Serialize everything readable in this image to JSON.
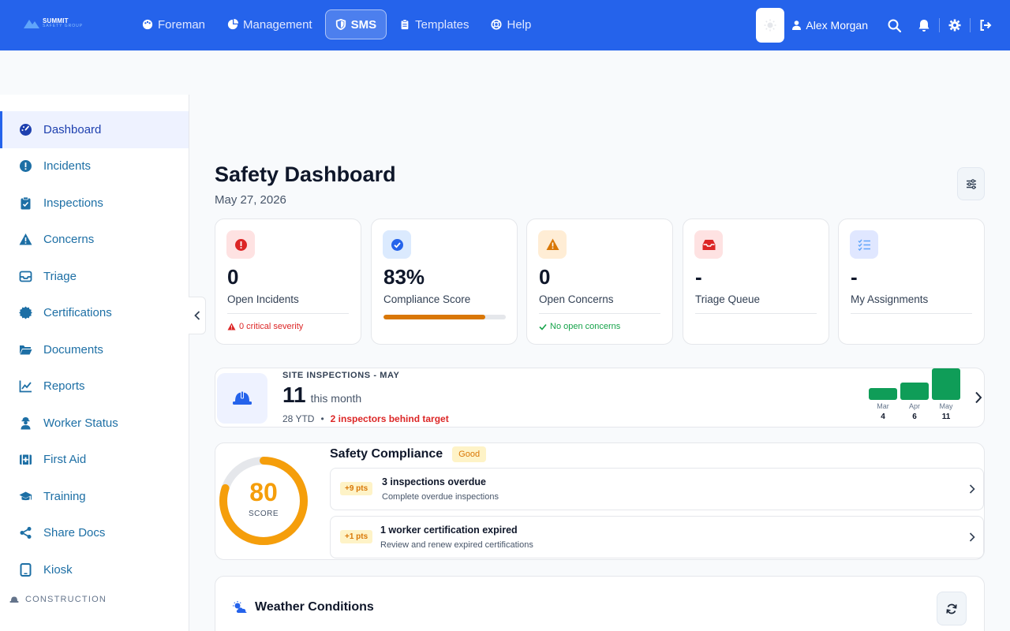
{
  "brand": {
    "name": "SUMMIT",
    "subtitle": "SAFETY GROUP"
  },
  "nav": [
    {
      "label": "Foreman",
      "icon": "palette-icon"
    },
    {
      "label": "Management",
      "icon": "pie-chart-icon"
    },
    {
      "label": "SMS",
      "icon": "shield-icon",
      "active": true
    },
    {
      "label": "Templates",
      "icon": "clipboard-icon"
    },
    {
      "label": "Help",
      "icon": "lifebuoy-icon"
    }
  ],
  "user": {
    "name": "Alex Morgan"
  },
  "sidebar": {
    "items": [
      {
        "label": "Dashboard",
        "icon": "gauge-icon",
        "active": true
      },
      {
        "label": "Incidents",
        "icon": "alert-circle-icon"
      },
      {
        "label": "Inspections",
        "icon": "clipboard-check-icon"
      },
      {
        "label": "Concerns",
        "icon": "warning-icon"
      },
      {
        "label": "Triage",
        "icon": "inbox-icon"
      },
      {
        "label": "Certifications",
        "icon": "certificate-icon"
      },
      {
        "label": "Documents",
        "icon": "folder-icon"
      },
      {
        "label": "Reports",
        "icon": "chart-line-icon"
      },
      {
        "label": "Worker Status",
        "icon": "worker-icon"
      },
      {
        "label": "First Aid",
        "icon": "first-aid-icon"
      },
      {
        "label": "Training",
        "icon": "graduation-cap-icon"
      },
      {
        "label": "Share Docs",
        "icon": "share-icon"
      },
      {
        "label": "Kiosk",
        "icon": "tablet-icon"
      }
    ],
    "section": "CONSTRUCTION"
  },
  "page": {
    "title": "Safety Dashboard",
    "date": "May 27, 2026"
  },
  "cards": [
    {
      "value": "0",
      "label": "Open Incidents",
      "foot": "0 critical severity"
    },
    {
      "value": "83%",
      "label": "Compliance Score",
      "progress": 0.83
    },
    {
      "value": "0",
      "label": "Open Concerns",
      "foot": "No open concerns"
    },
    {
      "value": "-",
      "label": "Triage Queue"
    },
    {
      "value": "-",
      "label": "My Assignments"
    }
  ],
  "inspections": {
    "heading": "SITE INSPECTIONS - MAY",
    "count": "11",
    "unit": "this month",
    "ytd": "28 YTD",
    "separator": "•",
    "warning": "2 inspectors behind target",
    "months": [
      {
        "month": "Mar",
        "value": 4
      },
      {
        "month": "Apr",
        "value": 6
      },
      {
        "month": "May",
        "value": 11
      }
    ]
  },
  "compliance": {
    "title": "Safety Compliance",
    "badge": "Good",
    "score": 80,
    "score_label": "SCORE",
    "items": [
      {
        "points": "+9 pts",
        "title": "3 inspections overdue",
        "subtitle": "Complete overdue inspections"
      },
      {
        "points": "+1 pts",
        "title": "1 worker certification expired",
        "subtitle": "Review and renew expired certifications"
      }
    ]
  },
  "weather": {
    "title": "Weather Conditions"
  },
  "colors": {
    "brand": "#2563eb",
    "danger": "#dc2626",
    "warning": "#d97706",
    "success": "#16a34a",
    "bar": "#0f9d58",
    "gauge": "#f59e0b"
  }
}
